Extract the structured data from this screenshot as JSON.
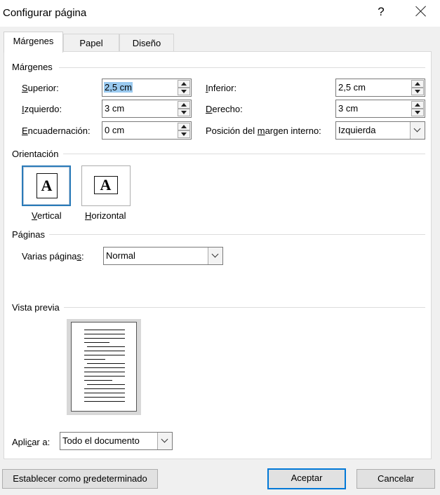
{
  "window": {
    "title": "Configurar página",
    "help_glyph": "?"
  },
  "tabs": [
    {
      "label": "Márgenes",
      "active": true
    },
    {
      "label": "Papel",
      "active": false
    },
    {
      "label": "Diseño",
      "active": false
    }
  ],
  "margins": {
    "section_label": "Márgenes",
    "superior": {
      "pre": "",
      "key": "S",
      "post": "uperior:",
      "value": "2,5 cm"
    },
    "inferior": {
      "pre": "",
      "key": "I",
      "post": "nferior:",
      "value": "2,5 cm"
    },
    "izquierdo": {
      "pre": "",
      "key": "I",
      "post": "zquierdo:",
      "value": "3 cm"
    },
    "derecho": {
      "pre": "",
      "key": "D",
      "post": "erecho:",
      "value": "3 cm"
    },
    "encuadernacion": {
      "pre": "",
      "key": "E",
      "post": "ncuadernación:",
      "value": "0 cm"
    },
    "posicion": {
      "pre": "Posición del ",
      "key": "m",
      "post": "argen interno:",
      "value": "Izquierda"
    }
  },
  "orientation": {
    "section_label": "Orientación",
    "glyph": "A",
    "vertical": {
      "key": "V",
      "post": "ertical",
      "selected": true
    },
    "horizontal": {
      "key": "H",
      "post": "orizontal",
      "selected": false
    }
  },
  "pages": {
    "section_label": "Páginas",
    "multiple": {
      "pre": "Varias página",
      "key": "s",
      "post": ":",
      "value": "Normal"
    }
  },
  "preview": {
    "section_label": "Vista previa"
  },
  "apply": {
    "pre": "Apli",
    "key": "c",
    "post": "ar a:",
    "value": "Todo el documento"
  },
  "buttons": {
    "default": {
      "pre": "Establecer como ",
      "key": "p",
      "post": "redeterminado"
    },
    "ok": "Aceptar",
    "cancel": "Cancelar"
  },
  "colors": {
    "accent": "#0078d7",
    "selection": "#99c9ef",
    "orientation_selected": "#2a7ab8"
  }
}
